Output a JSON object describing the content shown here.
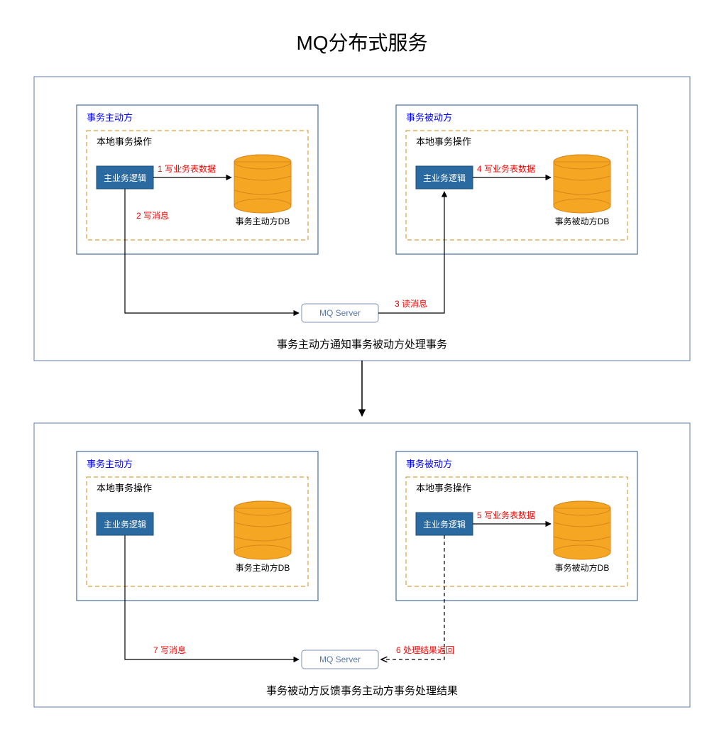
{
  "title": "MQ分布式服务",
  "sections": {
    "top": {
      "caption": "事务主动方通知事务被动方处理事务",
      "mq": "MQ Server",
      "active": {
        "title": "事务主动方",
        "local_label": "本地事务操作",
        "logic_box": "主业务逻辑",
        "db_label": "事务主动方DB",
        "step1": "1 写业务表数据",
        "step2": "2  写消息"
      },
      "passive": {
        "title": "事务被动方",
        "local_label": "本地事务操作",
        "logic_box": "主业务逻辑",
        "db_label": "事务被动方DB",
        "step3": "3  读消息",
        "step4": "4 写业务表数据"
      }
    },
    "bottom": {
      "caption": "事务被动方反馈事务主动方事务处理结果",
      "mq": "MQ Server",
      "active": {
        "title": "事务主动方",
        "local_label": "本地事务操作",
        "logic_box": "主业务逻辑",
        "db_label": "事务主动方DB",
        "step7": "7  写消息"
      },
      "passive": {
        "title": "事务被动方",
        "local_label": "本地事务操作",
        "logic_box": "主业务逻辑",
        "db_label": "事务被动方DB",
        "step5": "5 写业务表数据",
        "step6": "6   处理结果返回"
      }
    }
  },
  "colors": {
    "outer_border": "#7a92b7",
    "inner_border": "#4a6aa0",
    "dashed_border": "#d9a23f",
    "logic_fill": "#2a6aa0",
    "logic_fill2": "#3a78ad",
    "db_fill": "#f5a623",
    "db_stroke": "#d9861a",
    "red": "#ff0000",
    "blue": "#0000ff"
  }
}
